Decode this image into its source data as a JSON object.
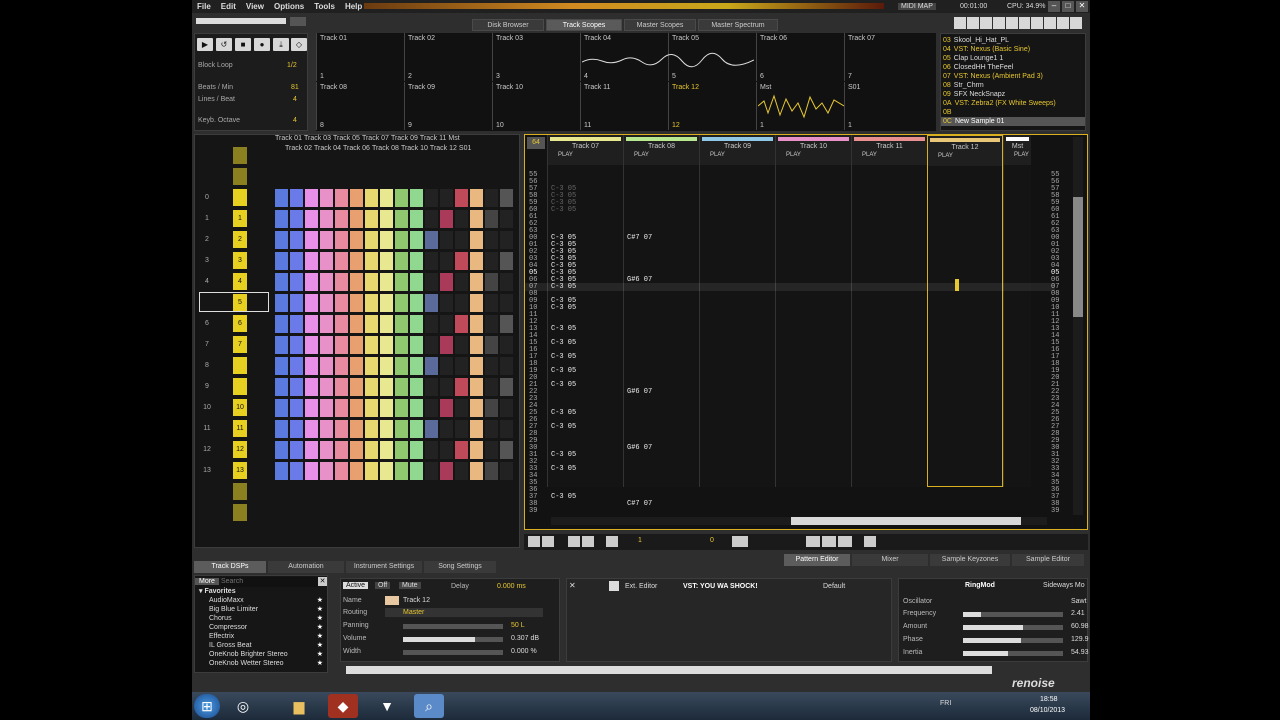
{
  "menu": [
    "File",
    "Edit",
    "View",
    "Options",
    "Tools",
    "Help"
  ],
  "status": {
    "midi_map": "MIDI MAP",
    "time": "00:01:00",
    "cpu": "CPU: 34.9%"
  },
  "view_tabs": [
    "Disk Browser",
    "Track Scopes",
    "Master Scopes",
    "Master Spectrum"
  ],
  "active_view_tab": "Track Scopes",
  "transport": {
    "block_loop_label": "Block Loop",
    "block_loop_value": "1/2",
    "bpm_label": "Beats / Min",
    "bpm_value": "81",
    "lpb_label": "Lines / Beat",
    "lpb_value": "4",
    "octave_label": "Keyb. Octave",
    "octave_value": "4"
  },
  "scopes_row1": [
    {
      "name": "Track 01",
      "num": "1"
    },
    {
      "name": "Track 02",
      "num": "2"
    },
    {
      "name": "Track 03",
      "num": "3"
    },
    {
      "name": "Track 04",
      "num": "4"
    },
    {
      "name": "Track 05",
      "num": "5"
    },
    {
      "name": "Track 06",
      "num": "6"
    },
    {
      "name": "Track 07",
      "num": "7"
    }
  ],
  "scopes_row2": [
    {
      "name": "Track 08",
      "num": "8"
    },
    {
      "name": "Track 09",
      "num": "9"
    },
    {
      "name": "Track 10",
      "num": "10"
    },
    {
      "name": "Track 11",
      "num": "11"
    },
    {
      "name": "Track 12",
      "num": "12"
    },
    {
      "name": "Mst",
      "num": "1"
    },
    {
      "name": "S01",
      "num": "1"
    }
  ],
  "instruments": [
    {
      "idx": "03",
      "name": "Skool_Hi_Hat_PL",
      "color": "#ddd"
    },
    {
      "idx": "04",
      "name": "VST: Nexus (Basic Sine)",
      "color": "#e8c830"
    },
    {
      "idx": "05",
      "name": "Clap Lounge1 1",
      "color": "#ddd"
    },
    {
      "idx": "06",
      "name": "ClosedHH TheFeel",
      "color": "#ddd"
    },
    {
      "idx": "07",
      "name": "VST: Nexus (Ambient Pad 3)",
      "color": "#e8c830"
    },
    {
      "idx": "08",
      "name": "Str_Chrm",
      "color": "#ddd"
    },
    {
      "idx": "09",
      "name": "SFX NeckSnapz",
      "color": "#ddd"
    },
    {
      "idx": "0A",
      "name": "VST: Zebra2 (FX White Sweeps)",
      "color": "#e8c830"
    },
    {
      "idx": "0B",
      "name": "",
      "color": "#ddd"
    },
    {
      "idx": "0C",
      "name": "New Sample 01",
      "color": "#fff"
    }
  ],
  "matrix_tracks_top": [
    "Track 01",
    "Track 03",
    "Track 05",
    "Track 07",
    "Track 09",
    "Track 11",
    "Mst"
  ],
  "matrix_tracks_bottom": [
    "Track 02",
    "Track 04",
    "Track 06",
    "Track 08",
    "Track 10",
    "Track 12",
    "S01"
  ],
  "sequence_numbers": [
    "0",
    "1",
    "2",
    "3",
    "4",
    "",
    "6",
    "7",
    "8",
    "9",
    "10",
    "11",
    "12",
    "13"
  ],
  "sequence_patterns": [
    "",
    "1",
    "2",
    "3",
    "4",
    "5",
    "6",
    "7",
    "",
    "",
    "10",
    "11",
    "12",
    "13"
  ],
  "pattern_editor": {
    "lines": "64",
    "tracks": [
      "Track 07",
      "Track 08",
      "Track 09",
      "Track 10",
      "Track 11",
      "Track 12",
      "Mst"
    ],
    "track_colors": [
      "#e8e890",
      "#b8e890",
      "#90c8e8",
      "#e890c8",
      "#e89090",
      "#e8c878",
      "#ffffff"
    ],
    "play_label": "PLAY",
    "row_labels": [
      "55",
      "56",
      "57",
      "58",
      "59",
      "60",
      "61",
      "62",
      "63",
      "00",
      "01",
      "02",
      "03",
      "04",
      "05",
      "06",
      "07",
      "08",
      "09",
      "10",
      "11",
      "12",
      "13",
      "14",
      "15",
      "16",
      "17",
      "18",
      "19",
      "20",
      "21",
      "22",
      "23",
      "24",
      "25",
      "26",
      "27",
      "28",
      "29",
      "30",
      "31",
      "32",
      "33",
      "34",
      "35",
      "36",
      "37",
      "38",
      "39"
    ],
    "notes_c": "C-3 05",
    "notes_g": "G#6 07",
    "notes_c7": "C#7 07"
  },
  "pe_footer": {
    "octave": "1",
    "step": "0"
  },
  "lower_tabs": [
    "Pattern Editor",
    "Mixer",
    "Sample Keyzones",
    "Sample Editor"
  ],
  "bottom_tabs": [
    "Track DSPs",
    "Automation",
    "Instrument Settings",
    "Song Settings"
  ],
  "dsp_browser": {
    "more": "More",
    "search_placeholder": "Search",
    "favorites": "Favorites",
    "items": [
      "AudioMaxx",
      "Big Blue Limiter",
      "Chorus",
      "Compressor",
      "Effectrix",
      "IL Gross Beat",
      "OneKnob Brighter Stereo",
      "OneKnob Wetter Stereo"
    ]
  },
  "track_props": {
    "active": "Active",
    "off": "Off",
    "mute": "Mute",
    "delay_label": "Delay",
    "delay_value": "0.000 ms",
    "name_label": "Name",
    "name_value": "Track 12",
    "routing_label": "Routing",
    "routing_value": "Master",
    "panning_label": "Panning",
    "panning_value": "50 L",
    "volume_label": "Volume",
    "volume_value": "0.307 dB",
    "width_label": "Width",
    "width_value": "0.000 %",
    "volume_level": 0.72
  },
  "vst": {
    "ext_editor": "Ext. Editor",
    "name": "VST: YOU WA SHOCK!",
    "preset": "Default"
  },
  "ringmod": {
    "title": "RingMod",
    "sideways": "Sideways Mo",
    "oscillator": "Oscillator",
    "frequency": "Frequency",
    "amount": "Amount",
    "phase": "Phase",
    "inertia": "Inertia",
    "values": [
      "Sawt",
      "2.41",
      "60.98",
      "129.9",
      "54.93"
    ]
  },
  "taskbar": {
    "clock_time": "18:58",
    "clock_date": "08/10/2013",
    "day": "FRI",
    "brand": "renoise"
  }
}
